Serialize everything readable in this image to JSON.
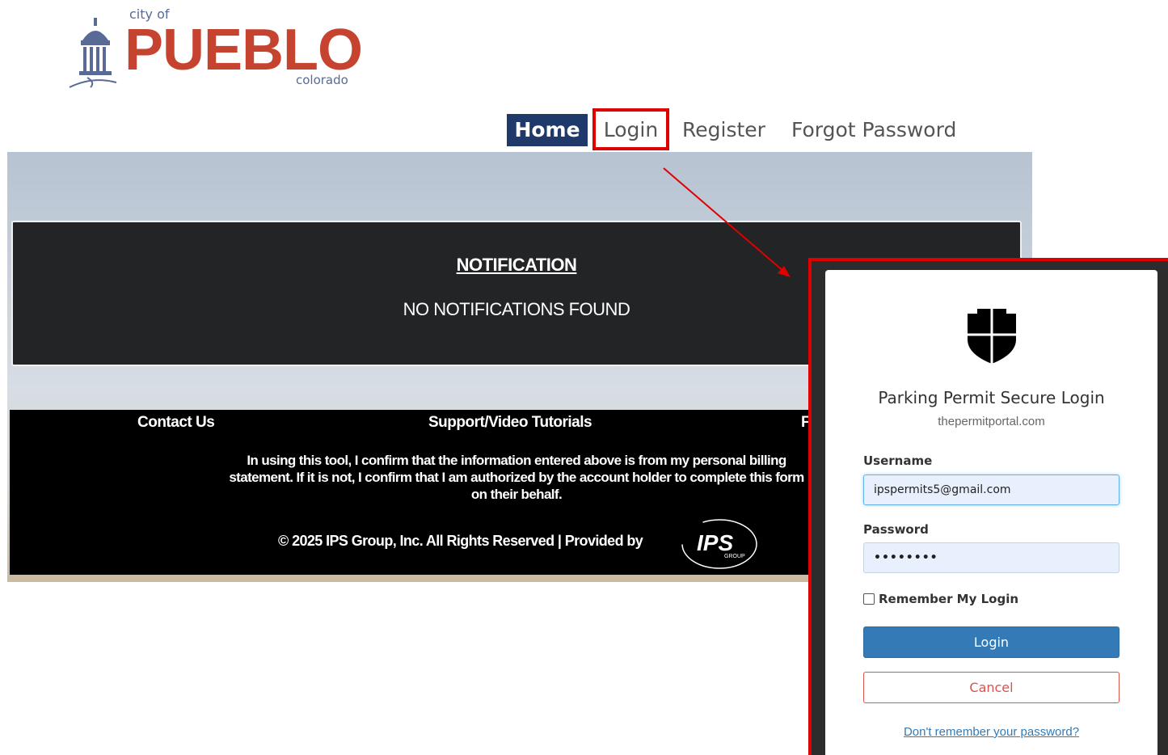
{
  "logo": {
    "city_of": "city of",
    "name": "PUEBLO",
    "state": "colorado"
  },
  "nav": {
    "home": "Home",
    "login": "Login",
    "register": "Register",
    "forgot_password": "Forgot Password"
  },
  "notification": {
    "title": "NOTIFICATION",
    "body": "NO NOTIFICATIONS FOUND"
  },
  "footer": {
    "contact": "Contact Us",
    "support": "Support/Video Tutorials",
    "third_link_partial": "F",
    "disclaimer": "In using this tool, I confirm that the information entered above is from my personal billing statement. If it is not, I confirm that I am authorized by the account holder to complete this form on their behalf.",
    "copyright": "© 2025 IPS Group, Inc. All Rights Reserved  |  Provided by",
    "provider_logo_text": "IPS",
    "provider_logo_sub": "GROUP"
  },
  "login_modal": {
    "icon": "shield-icon",
    "title": "Parking Permit Secure Login",
    "subtitle": "thepermitportal.com",
    "username_label": "Username",
    "username_value": "ipspermits5@gmail.com",
    "password_label": "Password",
    "password_value": "••••••••",
    "remember_label": "Remember My Login",
    "remember_checked": false,
    "login_button": "Login",
    "cancel_button": "Cancel",
    "forgot_link": "Don't remember your password?"
  },
  "colors": {
    "nav_home_bg": "#1f3a6a",
    "logo_red": "#c6442f",
    "highlight_red": "#e00000",
    "login_button": "#337ab7",
    "cancel_border": "#d9534f"
  }
}
